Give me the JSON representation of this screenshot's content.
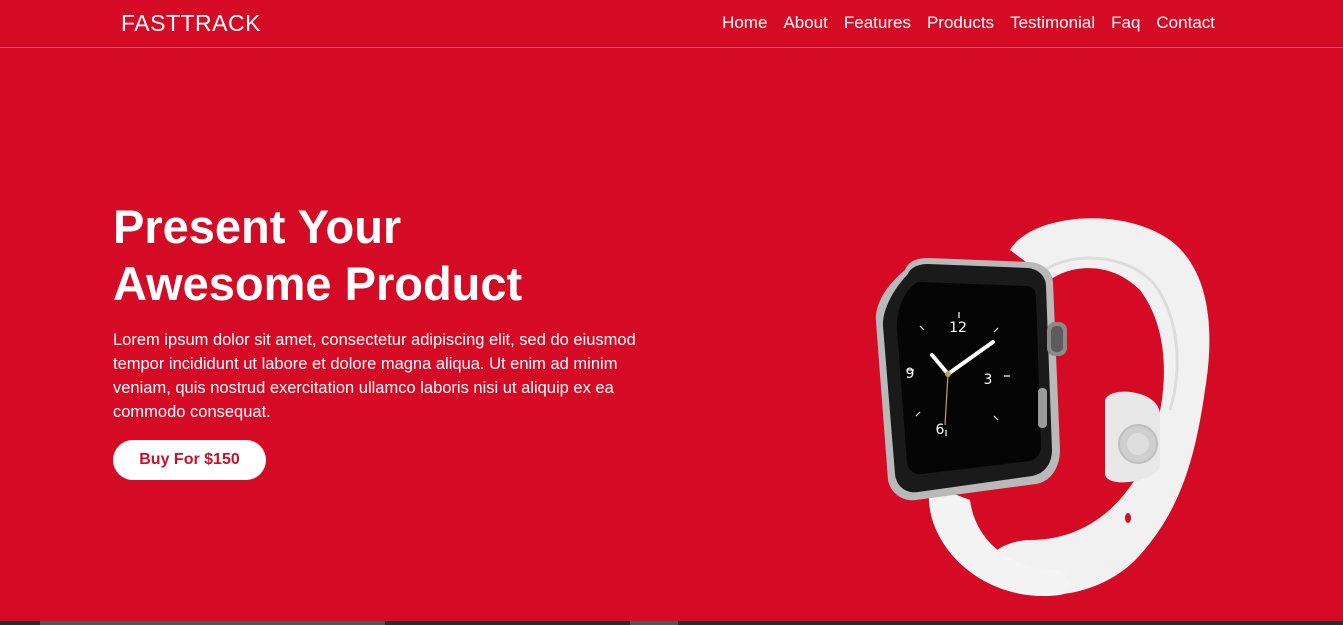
{
  "brand": {
    "name": "FASTTRACK"
  },
  "nav": {
    "items": [
      {
        "label": "Home"
      },
      {
        "label": "About"
      },
      {
        "label": "Features"
      },
      {
        "label": "Products"
      },
      {
        "label": "Testimonial"
      },
      {
        "label": "Faq"
      },
      {
        "label": "Contact"
      }
    ]
  },
  "hero": {
    "title_line1": "Present Your",
    "title_line2": "Awesome Product",
    "description": "Lorem ipsum dolor sit amet, consectetur adipiscing elit, sed do eiusmod tempor incididunt ut labore et dolore magna aliqua. Ut enim ad minim veniam, quis nostrud exercitation ullamco laboris nisi ut aliquip ex ea commodo consequat.",
    "button_label": "Buy For $150"
  },
  "watch": {
    "dial_numbers": [
      "12",
      "3",
      "6",
      "9"
    ],
    "image_icon": "smartwatch-icon"
  },
  "colors": {
    "background": "#d50b25",
    "button_bg": "#ffffff",
    "button_text": "#c8102e"
  }
}
